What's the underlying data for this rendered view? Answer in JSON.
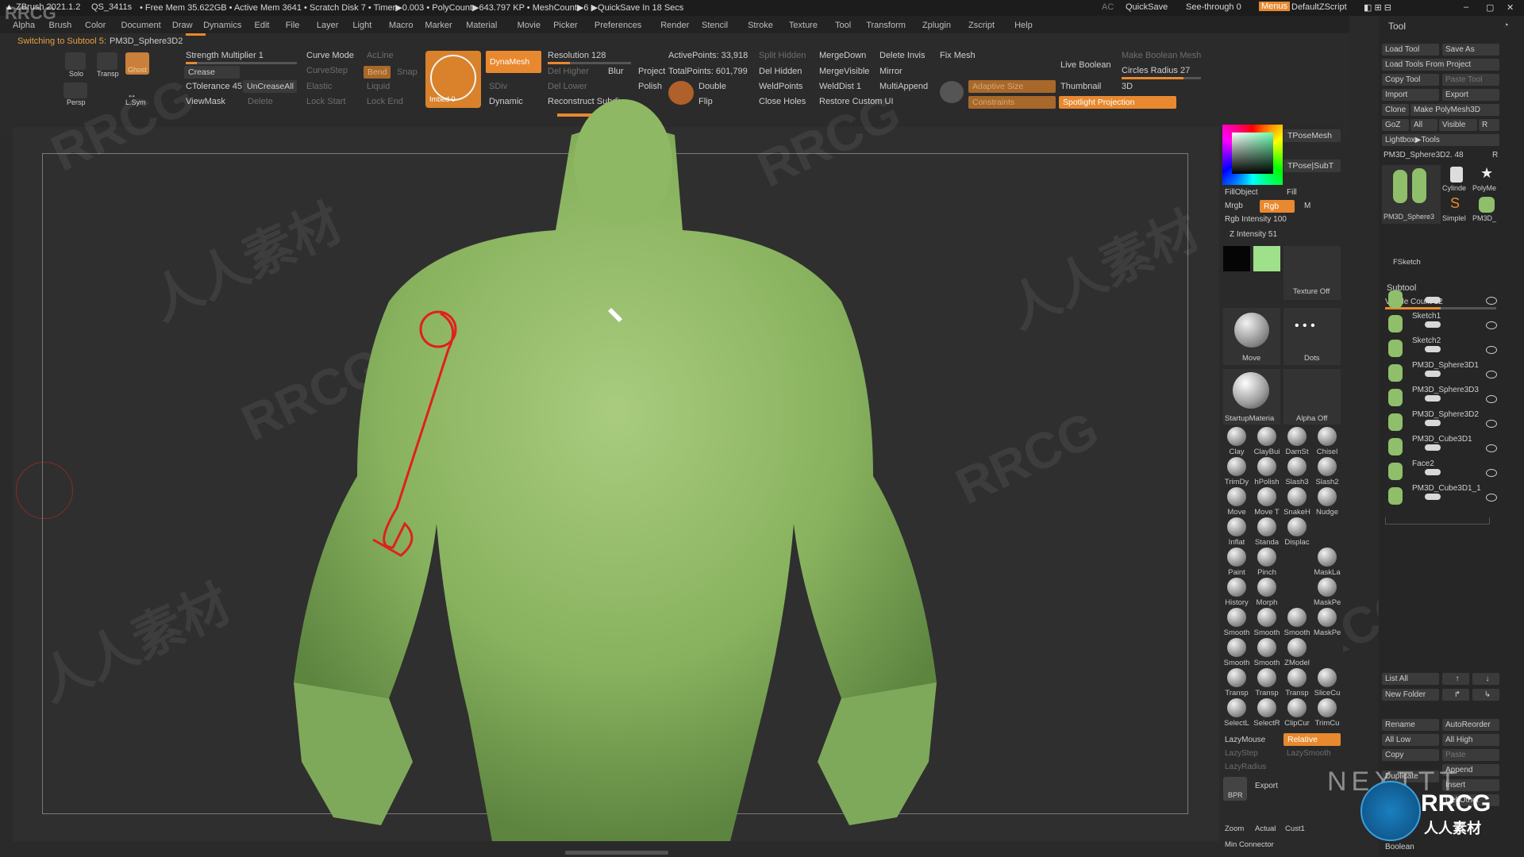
{
  "title_bar": {
    "app": "ZBrush 2021.1.2",
    "qs": "QS_3411s",
    "stats": "• Free Mem 35.622GB • Active Mem 3641 • Scratch Disk 7 • Timer▶0.003 • PolyCount▶643.797 KP • MeshCount▶6 ▶QuickSave In 18 Secs",
    "ac": "AC",
    "quicksave": "QuickSave",
    "see_through": "See-through  0",
    "menus": "Menus",
    "script": "DefaultZScript"
  },
  "menu": [
    "Alpha",
    "Brush",
    "Color",
    "Document",
    "Draw",
    "Dynamics",
    "Edit",
    "File",
    "Layer",
    "Light",
    "Macro",
    "Marker",
    "Material",
    "Movie",
    "Picker",
    "Preferences",
    "Render",
    "Stencil",
    "Stroke",
    "Texture",
    "Tool",
    "Transform",
    "Zplugin",
    "Zscript",
    "Help"
  ],
  "status": {
    "message": "Switching to Subtool 5:",
    "subtool": "PM3D_Sphere3D2"
  },
  "toolbar": {
    "solo": "Solo",
    "transp": "Transp",
    "ghost": "Ghost",
    "persp": "Persp",
    "lsym": "L.Sym",
    "strength": "Strength Multiplier  1",
    "crease": "Crease",
    "ctolerance": "CTolerance  45",
    "uncreaseall": "UnCreaseAll",
    "viewmask": "ViewMask",
    "curve_mode": "Curve Mode",
    "curvestep": "CurveStep",
    "acline": "AcLine",
    "bend": "Bend",
    "snap": "Snap",
    "elastic": "Elastic",
    "liquid": "Liquid",
    "lock_start": "Lock Start",
    "lock_end": "Lock End",
    "delete": "Delete",
    "imbed": "Imbed  0",
    "dynamesh": "DynaMesh",
    "blur": "Blur",
    "project": "Project",
    "polish": "Polish",
    "dynamic": "Dynamic",
    "resolution": "Resolution  128",
    "del_higher": "Del Higher",
    "del_lower": "Del Lower",
    "sdiv": "SDiv",
    "reconstruct": "Reconstruct Subdiv",
    "active_points": "ActivePoints: 33,918",
    "total_points": "TotalPoints: 601,799",
    "split_hidden": "Split Hidden",
    "del_hidden": "Del Hidden",
    "double": "Double",
    "flip": "Flip",
    "weldpoints": "WeldPoints",
    "close_holes": "Close Holes",
    "mergedown": "MergeDown",
    "mergevisible": "MergeVisible",
    "welddist": "WeldDist  1",
    "restore_ui": "Restore Custom UI",
    "delete_invis": "Delete Invis",
    "mirror": "Mirror",
    "multiappend": "MultiAppend",
    "fix_mesh": "Fix Mesh",
    "adaptive_size": "Adaptive Size",
    "constraints": "Constraints",
    "live_boolean": "Live Boolean",
    "make_boolean": "Make Boolean Mesh",
    "circles_radius": "Circles Radius  27",
    "thumbnail": "Thumbnail",
    "three_d": "3D",
    "spotlight": "Spotlight Projection"
  },
  "right_palette": {
    "tposemesh": "TPoseMesh",
    "tpose_subt": "TPose|SubT",
    "fillobject": "FillObject",
    "fill": "Fill",
    "mrgb": "Mrgb",
    "rgb": "Rgb",
    "m": "M",
    "rgb_intensity": "Rgb Intensity  100",
    "z_intensity": "Z Intensity  51",
    "texture_off": "Texture Off",
    "move": "Move",
    "dots": "Dots",
    "startup_material": "StartupMateria",
    "alpha_off": "Alpha Off",
    "lazymouse": "LazyMouse",
    "relative": "Relative",
    "lazystep": "LazyStep",
    "lazysmooth": "LazySmooth",
    "lazyradius": "LazyRadius",
    "bpr": "BPR",
    "export": "Export",
    "zoom": "Zoom",
    "actual": "Actual",
    "cust1": "Cust1",
    "min_connector": "Min Connector",
    "brushes": [
      "Clay",
      "ClayBui",
      "DamSt",
      "Chisel",
      "TrimDy",
      "hPolish",
      "Slash3",
      "Slash2",
      "Move",
      "Move T",
      "SnakeH",
      "Nudge",
      "Inflat",
      "Standa",
      "Displac",
      "",
      "Paint",
      "Pinch",
      "",
      "MaskLa",
      "History",
      "Morph",
      "",
      "MaskPe",
      "Smooth",
      "Smooth",
      "Smooth",
      "MaskPe",
      "Smooth",
      "Smooth",
      "ZModel",
      "",
      "Transp",
      "Transp",
      "Transp",
      "SliceCu",
      "SelectL",
      "SelectR",
      "ClipCur",
      "TrimCu"
    ]
  },
  "tool_panel": {
    "title": "Tool",
    "load_tool": "Load Tool",
    "save_as": "Save As",
    "load_from_project": "Load Tools From Project",
    "copy_tool": "Copy Tool",
    "paste_tool": "Paste Tool",
    "import": "Import",
    "export": "Export",
    "clone": "Clone",
    "make_polymesh": "Make PolyMesh3D",
    "goz": "GoZ",
    "all": "All",
    "visible": "Visible",
    "r": "R",
    "lightbox_tools": "Lightbox▶Tools",
    "current_tool": "PM3D_Sphere3D2.  48",
    "thumbs": [
      "PM3D_Sphere3",
      "Cylinde",
      "PolyMe",
      "SimpleI",
      "PM3D_"
    ],
    "fsketch": "FSketch",
    "subtool_header": "Subtool",
    "visible_count": "Visible Count  12",
    "subtools": [
      "",
      "Sketch1",
      "Sketch2",
      "PM3D_Sphere3D1",
      "PM3D_Sphere3D3",
      "PM3D_Sphere3D2",
      "PM3D_Cube3D1",
      "Face2",
      "PM3D_Cube3D1_1"
    ],
    "list_all": "List All",
    "new_folder": "New Folder",
    "rename": "Rename",
    "autoreorder": "AutoReorder",
    "all_low": "All Low",
    "all_high": "All High",
    "copy": "Copy",
    "paste": "Paste",
    "duplicate": "Duplicate",
    "append": "Append",
    "insert": "Insert",
    "del_other": "Del Other",
    "boolean": "Boolean"
  },
  "watermarks": [
    "RRCG",
    "人人素材",
    "RRCG",
    "人人素材",
    "RRCG",
    "RRCG",
    "人人素材",
    "RRCG"
  ],
  "branding": {
    "logo": "RRCG",
    "logo_sub": "人人素材",
    "nextt": "NEXTTT",
    "corner": "RRCG"
  }
}
